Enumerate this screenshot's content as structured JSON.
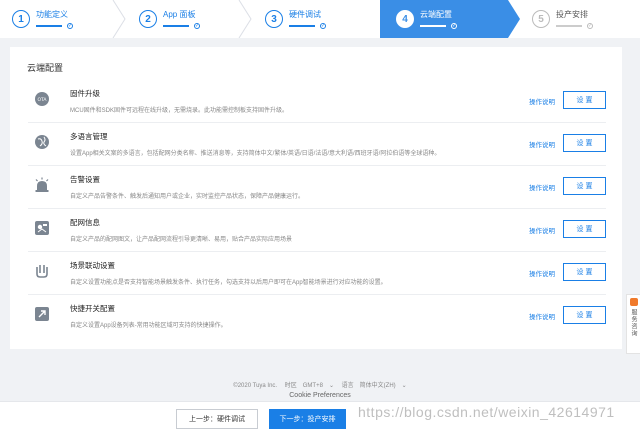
{
  "steps": [
    {
      "number": "1",
      "label": "功能定义",
      "state": "done"
    },
    {
      "number": "2",
      "label": "App 面板",
      "state": "done"
    },
    {
      "number": "3",
      "label": "硬件调试",
      "state": "done"
    },
    {
      "number": "4",
      "label": "云端配置",
      "state": "active"
    },
    {
      "number": "5",
      "label": "投产安排",
      "state": "pending"
    }
  ],
  "card": {
    "title": "云端配置",
    "rows": [
      {
        "icon": "ota-icon",
        "title": "固件升级",
        "desc": "MCU固件和SDK固件可远程在线升级，无需烧录。此功能需控制板支持固件升级。",
        "link": "操作说明",
        "button": "设 置"
      },
      {
        "icon": "globe-icon",
        "title": "多语言管理",
        "desc": "设置App相关文案的多语言，包括配网分类名称、推送消息等，支持简体中文/繁体/英语/日语/法语/意大利语/西班牙语/阿拉伯语等全球语种。",
        "link": "操作说明",
        "button": "设 置"
      },
      {
        "icon": "alarm-icon",
        "title": "告警设置",
        "desc": "自定义产品告警条件、触发后通知用户或企业，实时监控产品状态，保障产品健康运行。",
        "link": "操作说明",
        "button": "设 置"
      },
      {
        "icon": "network-icon",
        "title": "配网信息",
        "desc": "自定义产品的配网图文，让产品配网流程引导更清晰、易用，贴合产品实际应用场景",
        "link": "操作说明",
        "button": "设 置"
      },
      {
        "icon": "scene-icon",
        "title": "场景联动设置",
        "desc": "自定义设置功能点是否支持智能场景触发条件、执行任务，勾选支持以后用户即可在App智能场景进行对应功能的设置。",
        "link": "操作说明",
        "button": "设 置"
      },
      {
        "icon": "shortcut-icon",
        "title": "快捷开关配置",
        "desc": "自定义设置App设备列表-常用功能区域可支持的快捷操作。",
        "link": "操作说明",
        "button": "设 置"
      }
    ]
  },
  "footer": {
    "copyright": "©2020 Tuya Inc.",
    "timezone_label": "时区",
    "timezone_value": "GMT+8",
    "language_label": "语言",
    "language_value": "简体中文(ZH)",
    "cookie": "Cookie Preferences"
  },
  "actions": {
    "prev": "上一步：硬件调试",
    "next": "下一步：投产安排"
  },
  "watermark": "https://blog.csdn.net/weixin_42614971",
  "side_tab": {
    "label": "服务咨询"
  },
  "colors": {
    "accent": "#1a7fe6",
    "active_step": "#3a8ee6",
    "side_dot": "#f07a2b"
  }
}
